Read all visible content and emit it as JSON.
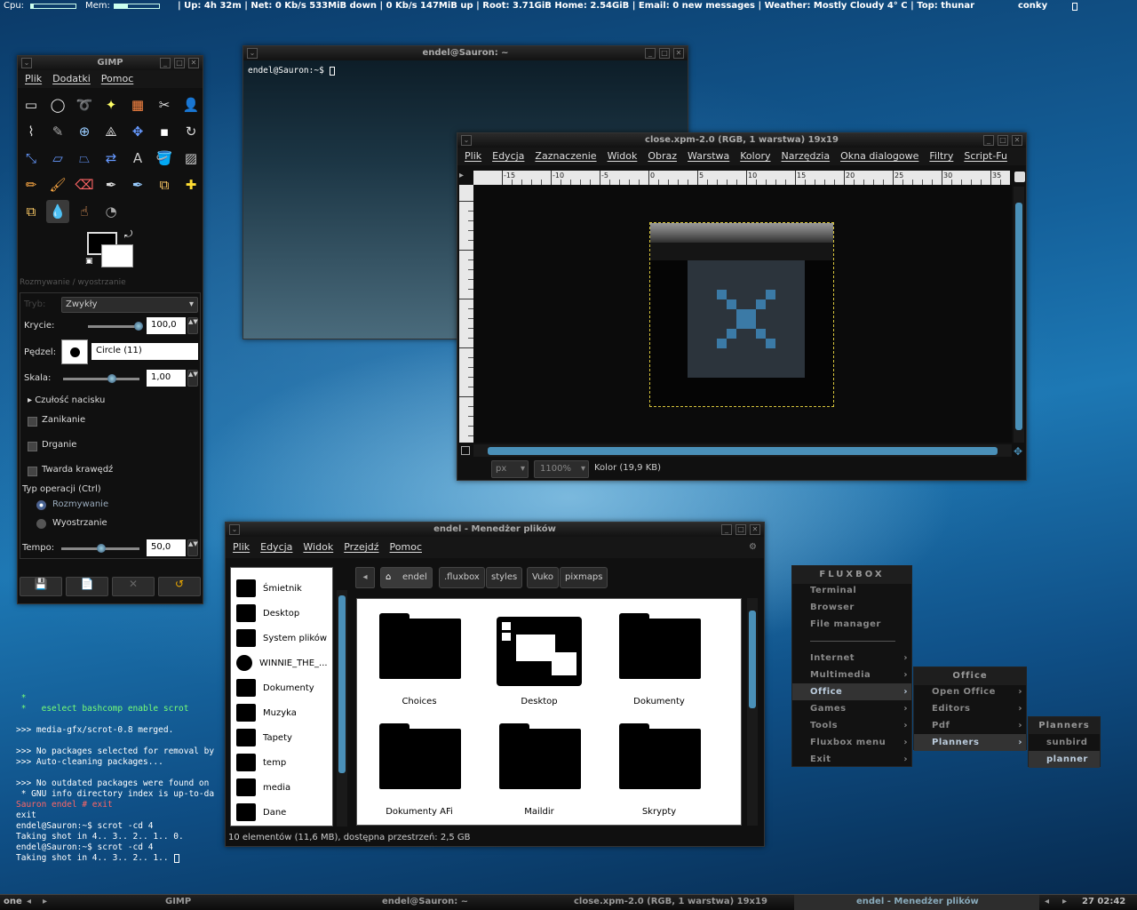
{
  "conky": {
    "cpu_label": "Cpu:",
    "mem_label": "Mem:",
    "uptime": "| Up: 4h 32m | Net: 0 Kb/s 533MiB down | 0 Kb/s 147MiB up | Root: 3.71GiB Home: 2.54GiB | Email: 0 new messages | Weather: Mostly Cloudy 4° C | Top: thunar",
    "top2": "conky",
    "cpu_pct": 0.05,
    "mem_pct": 0.3
  },
  "gimp": {
    "title": "GIMP",
    "menu": [
      "Plik",
      "Dodatki",
      "Pomoc"
    ],
    "tool_options_label": "Rozmywanie / wyostrzanie",
    "mode_label": "Tryb:",
    "mode_value": "Zwykły",
    "opacity_label": "Krycie:",
    "opacity_value": "100,0",
    "brush_label": "Pędzel:",
    "brush_value": "Circle (11)",
    "scale_label": "Skala:",
    "scale_value": "1,00",
    "pressure": "Czułość nacisku",
    "fade": "Zanikanie",
    "jitter": "Drganie",
    "hard_edge": "Twarda krawędź",
    "optype_label": "Typ operacji  (Ctrl)",
    "opt_blur": "Rozmywanie",
    "opt_sharpen": "Wyostrzanie",
    "rate_label": "Tempo:",
    "rate_value": "50,0"
  },
  "terminal_top": {
    "title": "endel@Sauron: ~",
    "prompt": "endel@Sauron:~$ "
  },
  "image_window": {
    "title": "close.xpm-2.0 (RGB, 1 warstwa) 19x19",
    "menu": [
      "Plik",
      "Edycja",
      "Zaznaczenie",
      "Widok",
      "Obraz",
      "Warstwa",
      "Kolory",
      "Narzędzia",
      "Okna dialogowe",
      "Filtry",
      "Script-Fu"
    ],
    "ruler_ticks": [
      "-15",
      "-10",
      "-5",
      "0",
      "5",
      "10",
      "15",
      "20",
      "25",
      "30",
      "35"
    ],
    "unit": "px",
    "zoom": "1100%",
    "status": "Kolor (19,9 KB)"
  },
  "file_manager": {
    "title": "endel - Menedżer plików",
    "menu": [
      "Plik",
      "Edycja",
      "Widok",
      "Przejdź",
      "Pomoc"
    ],
    "sidebar": [
      "Śmietnik",
      "Desktop",
      "System plików",
      "WINNIE_THE_...",
      "Dokumenty",
      "Muzyka",
      "Tapety",
      "temp",
      "media",
      "Dane"
    ],
    "breadcrumbs": [
      "endel",
      ".fluxbox",
      "styles",
      "Vuko",
      "pixmaps"
    ],
    "files": [
      "Choices",
      "Desktop",
      "Dokumenty",
      "Dokumenty AFi",
      "Maildir",
      "Skrypty"
    ],
    "status": "10 elementów (11,6 MB), dostępna przestrzeń: 2,5 GB"
  },
  "desktop_terminal": {
    "lines": [
      " *",
      " *   eselect bashcomp enable scrot",
      "",
      ">>> media-gfx/scrot-0.8 merged.",
      "",
      ">>> No packages selected for removal by",
      ">>> Auto-cleaning packages...",
      "",
      ">>> No outdated packages were found on",
      " * GNU info directory index is up-to-da",
      "Sauron endel # exit",
      "exit",
      "endel@Sauron:~$ scrot -cd 4",
      "Taking shot in 4.. 3.. 2.. 1.. 0.",
      "endel@Sauron:~$ scrot -cd 4",
      "Taking shot in 4.. 3.. 2.. 1.. "
    ]
  },
  "fluxbox_menu": {
    "title": "FLUXBOX",
    "items": [
      "Terminal",
      "Browser",
      "File manager",
      "Internet",
      "Multimedia",
      "Office",
      "Games",
      "Tools",
      "Fluxbox menu",
      "Exit"
    ],
    "office_title": "Office",
    "office_items": [
      "Open Office",
      "Editors",
      "Pdf",
      "Planners"
    ],
    "planners_title": "Planners",
    "planners_items": [
      "sunbird",
      "planner"
    ]
  },
  "taskbar": {
    "workspace": "one",
    "tasks": [
      "GIMP",
      "endel@Sauron: ~",
      "close.xpm-2.0 (RGB, 1 warstwa) 19x19",
      "endel - Menedżer plików"
    ],
    "clock": "27 02:42"
  }
}
